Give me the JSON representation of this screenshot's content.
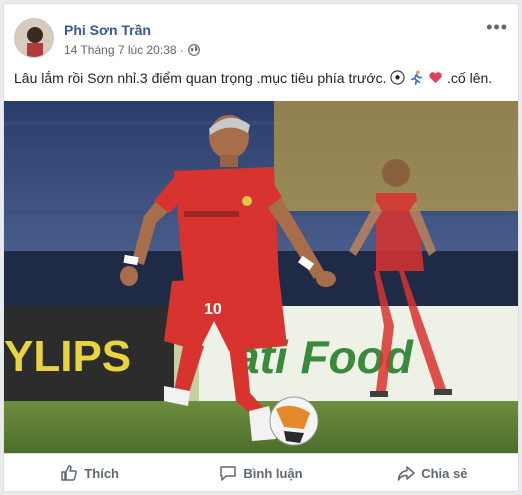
{
  "post": {
    "author": "Phi Sơn Trần",
    "timestamp": "14 Tháng 7 lúc 20:38 ·",
    "privacy_icon": "globe-icon",
    "text_main": "Lâu lắm rồi Sơn nhỉ.3 điểm quan trọng .mục tiêu phía trước.",
    "text_end": ".cố lên.",
    "emojis": [
      "soccer-ball",
      "runner",
      "red-heart"
    ]
  },
  "photo": {
    "jersey_number": "10",
    "banner_left": "YLIPS",
    "banner_right": "ati Food"
  },
  "actions": {
    "like": "Thích",
    "comment": "Bình luận",
    "share": "Chia sẻ"
  },
  "colors": {
    "link": "#385898",
    "kit_red": "#d9332f"
  }
}
